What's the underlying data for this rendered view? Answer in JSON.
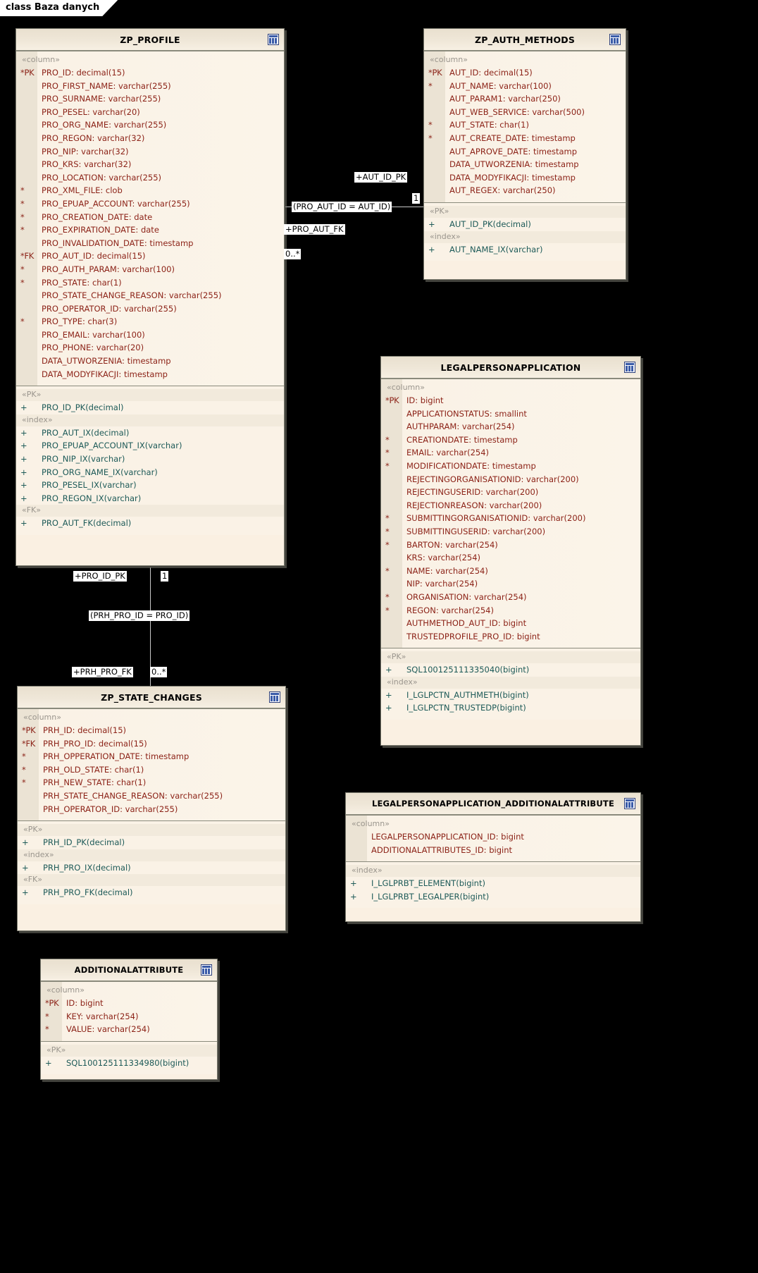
{
  "diagram": {
    "frame_label": "class Baza danych"
  },
  "icons": {
    "table": "table-icon"
  },
  "classes": {
    "zp_profile": {
      "name": "ZP_PROFILE",
      "compartments": [
        {
          "stereotype": "«column»",
          "rows": [
            {
              "mark": "*PK",
              "text": "PRO_ID:  decimal(15)"
            },
            {
              "mark": "",
              "text": "PRO_FIRST_NAME:  varchar(255)"
            },
            {
              "mark": "",
              "text": "PRO_SURNAME:  varchar(255)"
            },
            {
              "mark": "",
              "text": "PRO_PESEL:  varchar(20)"
            },
            {
              "mark": "",
              "text": "PRO_ORG_NAME:  varchar(255)"
            },
            {
              "mark": "",
              "text": "PRO_REGON:  varchar(32)"
            },
            {
              "mark": "",
              "text": "PRO_NIP:  varchar(32)"
            },
            {
              "mark": "",
              "text": "PRO_KRS:  varchar(32)"
            },
            {
              "mark": "",
              "text": "PRO_LOCATION:  varchar(255)"
            },
            {
              "mark": "*",
              "text": "PRO_XML_FILE:  clob"
            },
            {
              "mark": "*",
              "text": "PRO_EPUAP_ACCOUNT:  varchar(255)"
            },
            {
              "mark": "*",
              "text": "PRO_CREATION_DATE:  date"
            },
            {
              "mark": "*",
              "text": "PRO_EXPIRATION_DATE:  date"
            },
            {
              "mark": "",
              "text": "PRO_INVALIDATION_DATE:  timestamp"
            },
            {
              "mark": "*FK",
              "text": "PRO_AUT_ID:  decimal(15)"
            },
            {
              "mark": "*",
              "text": "PRO_AUTH_PARAM:  varchar(100)"
            },
            {
              "mark": "*",
              "text": "PRO_STATE:  char(1)"
            },
            {
              "mark": "",
              "text": "PRO_STATE_CHANGE_REASON:  varchar(255)"
            },
            {
              "mark": "",
              "text": "PRO_OPERATOR_ID:  varchar(255)"
            },
            {
              "mark": "*",
              "text": "PRO_TYPE:  char(3)"
            },
            {
              "mark": "",
              "text": "PRO_EMAIL:  varchar(100)"
            },
            {
              "mark": "",
              "text": "PRO_PHONE:  varchar(20)"
            },
            {
              "mark": "",
              "text": "DATA_UTWORZENIA:  timestamp"
            },
            {
              "mark": "",
              "text": "DATA_MODYFIKACJI:  timestamp"
            }
          ]
        },
        {
          "groups": [
            {
              "stereotype": "«PK»",
              "rows": [
                {
                  "mark": "+",
                  "text": "PRO_ID_PK(decimal)"
                }
              ]
            },
            {
              "stereotype": "«index»",
              "rows": [
                {
                  "mark": "+",
                  "text": "PRO_AUT_IX(decimal)"
                },
                {
                  "mark": "+",
                  "text": "PRO_EPUAP_ACCOUNT_IX(varchar)"
                },
                {
                  "mark": "+",
                  "text": "PRO_NIP_IX(varchar)"
                },
                {
                  "mark": "+",
                  "text": "PRO_ORG_NAME_IX(varchar)"
                },
                {
                  "mark": "+",
                  "text": "PRO_PESEL_IX(varchar)"
                },
                {
                  "mark": "+",
                  "text": "PRO_REGON_IX(varchar)"
                }
              ]
            },
            {
              "stereotype": "«FK»",
              "rows": [
                {
                  "mark": "+",
                  "text": "PRO_AUT_FK(decimal)"
                }
              ]
            }
          ]
        }
      ]
    },
    "zp_auth_methods": {
      "name": "ZP_AUTH_METHODS",
      "compartments": [
        {
          "stereotype": "«column»",
          "rows": [
            {
              "mark": "*PK",
              "text": "AUT_ID:  decimal(15)"
            },
            {
              "mark": "*",
              "text": "AUT_NAME:  varchar(100)"
            },
            {
              "mark": "",
              "text": "AUT_PARAM1:  varchar(250)"
            },
            {
              "mark": "",
              "text": "AUT_WEB_SERVICE:  varchar(500)"
            },
            {
              "mark": "*",
              "text": "AUT_STATE:  char(1)"
            },
            {
              "mark": "*",
              "text": "AUT_CREATE_DATE:  timestamp"
            },
            {
              "mark": "",
              "text": "AUT_APROVE_DATE:  timestamp"
            },
            {
              "mark": "",
              "text": "DATA_UTWORZENIA:  timestamp"
            },
            {
              "mark": "",
              "text": "DATA_MODYFIKACJI:  timestamp"
            },
            {
              "mark": "",
              "text": "AUT_REGEX:  varchar(250)"
            }
          ]
        },
        {
          "groups": [
            {
              "stereotype": "«PK»",
              "rows": [
                {
                  "mark": "+",
                  "text": "AUT_ID_PK(decimal)"
                }
              ]
            },
            {
              "stereotype": "«index»",
              "rows": [
                {
                  "mark": "+",
                  "text": "AUT_NAME_IX(varchar)"
                }
              ]
            }
          ]
        }
      ]
    },
    "legalpersonapplication": {
      "name": "LEGALPERSONAPPLICATION",
      "compartments": [
        {
          "stereotype": "«column»",
          "rows": [
            {
              "mark": "*PK",
              "text": "ID:  bigint"
            },
            {
              "mark": "",
              "text": "APPLICATIONSTATUS:  smallint"
            },
            {
              "mark": "",
              "text": "AUTHPARAM:  varchar(254)"
            },
            {
              "mark": "*",
              "text": "CREATIONDATE:  timestamp"
            },
            {
              "mark": "*",
              "text": "EMAIL:  varchar(254)"
            },
            {
              "mark": "*",
              "text": "MODIFICATIONDATE:  timestamp"
            },
            {
              "mark": "",
              "text": "REJECTINGORGANISATIONID:  varchar(200)"
            },
            {
              "mark": "",
              "text": "REJECTINGUSERID:  varchar(200)"
            },
            {
              "mark": "",
              "text": "REJECTIONREASON:  varchar(200)"
            },
            {
              "mark": "*",
              "text": "SUBMITTINGORGANISATIONID:  varchar(200)"
            },
            {
              "mark": "*",
              "text": "SUBMITTINGUSERID:  varchar(200)"
            },
            {
              "mark": "*",
              "text": "BARTON:  varchar(254)"
            },
            {
              "mark": "",
              "text": "KRS:  varchar(254)"
            },
            {
              "mark": "*",
              "text": "NAME:  varchar(254)"
            },
            {
              "mark": "",
              "text": "NIP:  varchar(254)"
            },
            {
              "mark": "*",
              "text": "ORGANISATION:  varchar(254)"
            },
            {
              "mark": "*",
              "text": "REGON:  varchar(254)"
            },
            {
              "mark": "",
              "text": "AUTHMETHOD_AUT_ID:  bigint"
            },
            {
              "mark": "",
              "text": "TRUSTEDPROFILE_PRO_ID:  bigint"
            }
          ]
        },
        {
          "groups": [
            {
              "stereotype": "«PK»",
              "rows": [
                {
                  "mark": "+",
                  "text": "SQL100125111335040(bigint)"
                }
              ]
            },
            {
              "stereotype": "«index»",
              "rows": [
                {
                  "mark": "+",
                  "text": "I_LGLPCTN_AUTHMETH(bigint)"
                },
                {
                  "mark": "+",
                  "text": "I_LGLPCTN_TRUSTEDP(bigint)"
                }
              ]
            }
          ]
        }
      ]
    },
    "zp_state_changes": {
      "name": "ZP_STATE_CHANGES",
      "compartments": [
        {
          "stereotype": "«column»",
          "rows": [
            {
              "mark": "*PK",
              "text": "PRH_ID:  decimal(15)"
            },
            {
              "mark": "*FK",
              "text": "PRH_PRO_ID:  decimal(15)"
            },
            {
              "mark": "*",
              "text": "PRH_OPPERATION_DATE:  timestamp"
            },
            {
              "mark": "*",
              "text": "PRH_OLD_STATE:  char(1)"
            },
            {
              "mark": "*",
              "text": "PRH_NEW_STATE:  char(1)"
            },
            {
              "mark": "",
              "text": "PRH_STATE_CHANGE_REASON:  varchar(255)"
            },
            {
              "mark": "",
              "text": "PRH_OPERATOR_ID:  varchar(255)"
            }
          ]
        },
        {
          "groups": [
            {
              "stereotype": "«PK»",
              "rows": [
                {
                  "mark": "+",
                  "text": "PRH_ID_PK(decimal)"
                }
              ]
            },
            {
              "stereotype": "«index»",
              "rows": [
                {
                  "mark": "+",
                  "text": "PRH_PRO_IX(decimal)"
                }
              ]
            },
            {
              "stereotype": "«FK»",
              "rows": [
                {
                  "mark": "+",
                  "text": "PRH_PRO_FK(decimal)"
                }
              ]
            }
          ]
        }
      ]
    },
    "lpa_additionalattribute": {
      "name": "LEGALPERSONAPPLICATION_ADDITIONALATTRIBUTE",
      "compartments": [
        {
          "stereotype": "«column»",
          "rows": [
            {
              "mark": "",
              "text": "LEGALPERSONAPPLICATION_ID:  bigint"
            },
            {
              "mark": "",
              "text": "ADDITIONALATTRIBUTES_ID:  bigint"
            }
          ]
        },
        {
          "groups": [
            {
              "stereotype": "«index»",
              "rows": [
                {
                  "mark": "+",
                  "text": "I_LGLPRBT_ELEMENT(bigint)"
                },
                {
                  "mark": "+",
                  "text": "I_LGLPRBT_LEGALPER(bigint)"
                }
              ]
            }
          ]
        }
      ]
    },
    "additionalattribute": {
      "name": "ADDITIONALATTRIBUTE",
      "compartments": [
        {
          "stereotype": "«column»",
          "rows": [
            {
              "mark": "*PK",
              "text": "ID:  bigint"
            },
            {
              "mark": "*",
              "text": "KEY:  varchar(254)"
            },
            {
              "mark": "*",
              "text": "VALUE:  varchar(254)"
            }
          ]
        },
        {
          "groups": [
            {
              "stereotype": "«PK»",
              "rows": [
                {
                  "mark": "+",
                  "text": "SQL100125111334980(bigint)"
                }
              ]
            }
          ]
        }
      ]
    }
  },
  "connectors": {
    "profile_auth": {
      "target_role": "+AUT_ID_PK",
      "target_mult": "1",
      "condition": "(PRO_AUT_ID = AUT_ID)",
      "source_role": "+PRO_AUT_FK",
      "source_mult": "0..*"
    },
    "profile_state": {
      "source_role": "+PRO_ID_PK",
      "source_mult": "1",
      "condition": "(PRH_PRO_ID = PRO_ID)",
      "target_role": "+PRH_PRO_FK",
      "target_mult": "0..*"
    }
  }
}
